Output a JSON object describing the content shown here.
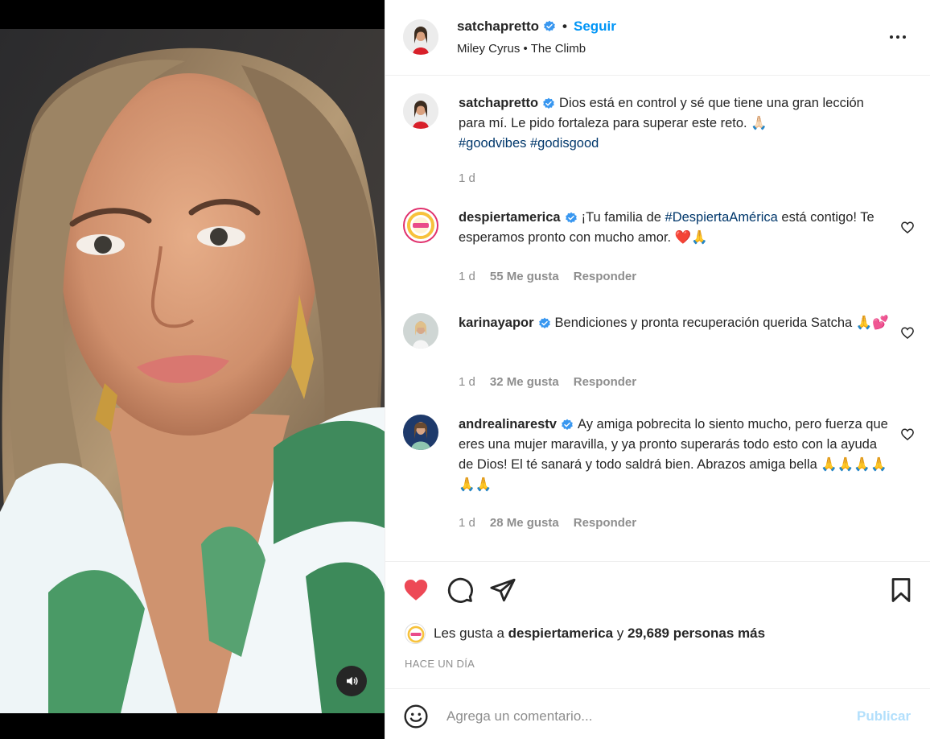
{
  "post": {
    "username": "satchapretto",
    "follow_label": "Seguir",
    "song_artist": "Miley Cyrus",
    "song_sep": "•",
    "song_title": "The Climb",
    "more_icon": "more-horizontal-icon"
  },
  "caption": {
    "username": "satchapretto",
    "text": "Dios está en control y sé que tiene una gran lección para mí. Le pido fortaleza para superar este reto. 🙏🏻",
    "hashtags": "#goodvibes #godisgood",
    "time": "1 d"
  },
  "comments": [
    {
      "username": "despiertamerica",
      "text_before": "¡Tu familia de ",
      "tag": "#DespiertaAmérica",
      "text_after": " está contigo! Te esperamos pronto con mucho amor. ❤️🙏",
      "time": "1 d",
      "likes": "55 Me gusta",
      "reply": "Responder"
    },
    {
      "username": "karinayapor",
      "text": "Bendiciones y pronta recuperación querida Satcha 🙏💕",
      "time": "1 d",
      "likes": "32 Me gusta",
      "reply": "Responder"
    },
    {
      "username": "andrealinarestv",
      "text": "Ay amiga pobrecita lo siento mucho, pero fuerza que eres una mujer maravilla, y ya pronto superarás todo esto con la ayuda de Dios! El té sanará y todo saldrá bien. Abrazos amiga bella 🙏🙏🙏🙏🙏🙏",
      "time": "1 d",
      "likes": "28 Me gusta",
      "reply": "Responder"
    }
  ],
  "actions": {
    "liked": true,
    "like_color": "#ed4956",
    "likes_prefix": "Les gusta a ",
    "likes_user": "despiertamerica",
    "likes_mid": " y ",
    "likes_count": "29,689 personas más",
    "date": "HACE UN DÍA"
  },
  "comment_box": {
    "placeholder": "Agrega un comentario...",
    "publish_label": "Publicar"
  },
  "colors": {
    "accent": "#0095f6",
    "verified": "#3897f0",
    "publish_disabled": "#b2dffc"
  }
}
